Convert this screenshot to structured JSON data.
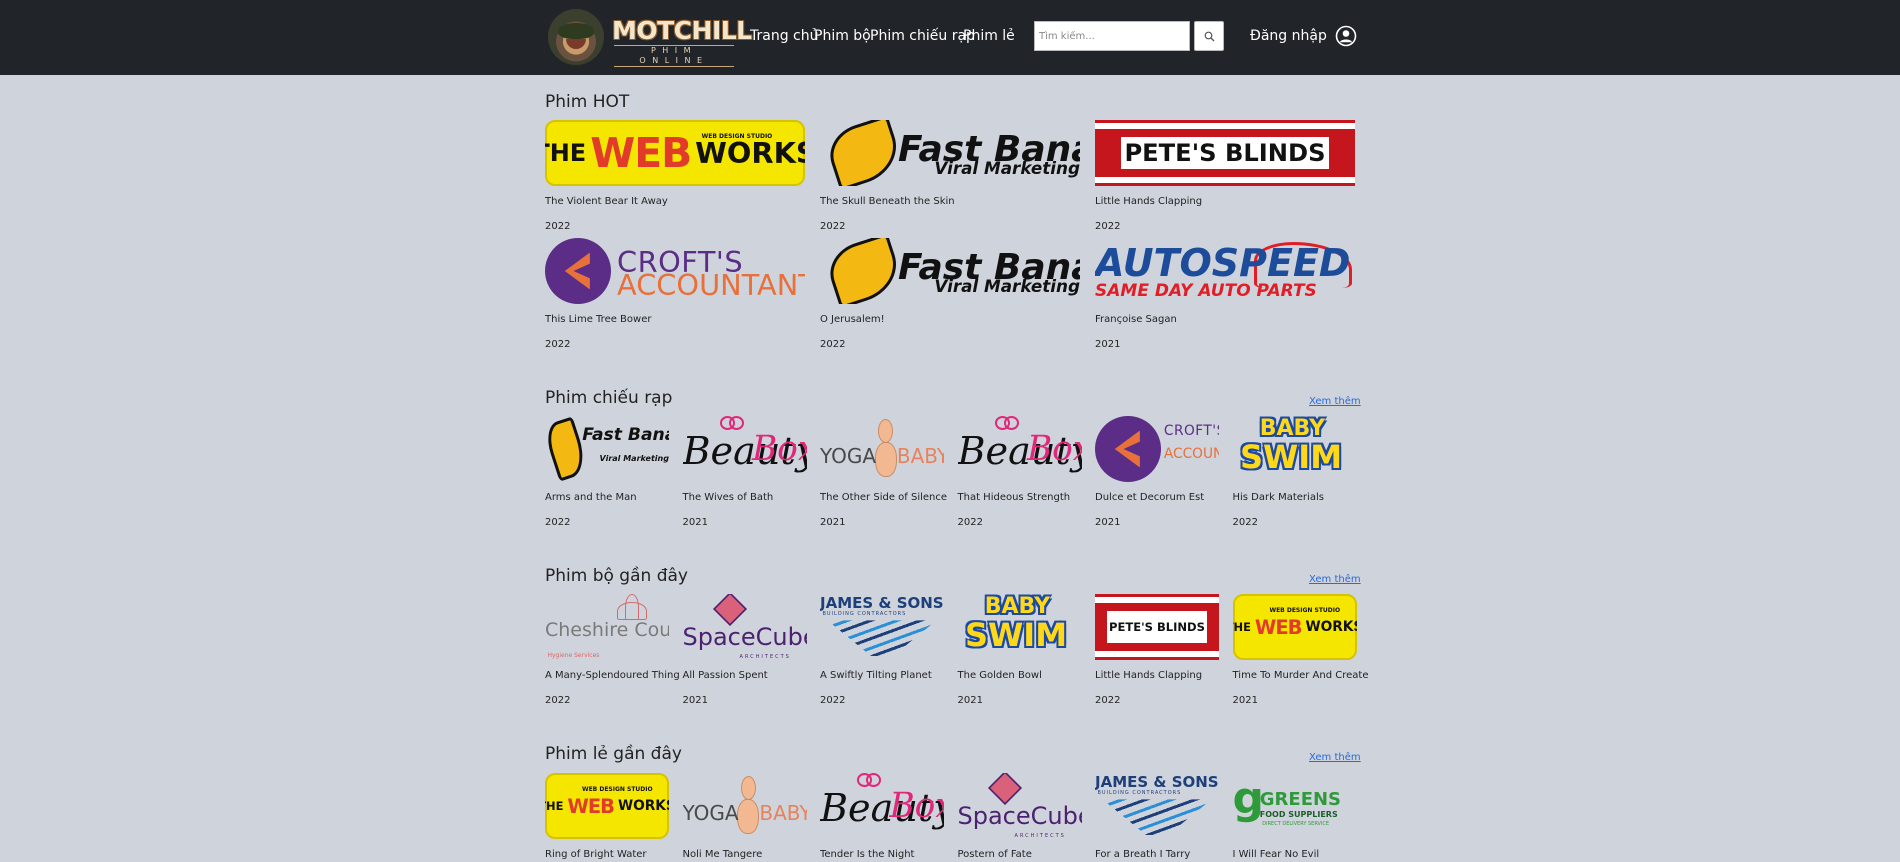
{
  "header": {
    "logo_main": "MOTCHILL",
    "logo_sub": "PHIM ONLINE",
    "nav": [
      "Trang chủ",
      "Phim bộ",
      "Phim chiếu rạp",
      "Phim lẻ"
    ],
    "search_placeholder": "Tìm kiếm...",
    "login": "Đăng nhập"
  },
  "sections": {
    "hot": {
      "title": "Phim HOT",
      "items": [
        {
          "title": "The Violent Bear It Away",
          "year": "2022",
          "logo": "THE WEB WORKS"
        },
        {
          "title": "The Skull Beneath the Skin",
          "year": "2022",
          "logo": "Fast Banana"
        },
        {
          "title": "Little Hands Clapping",
          "year": "2022",
          "logo": "PETE'S BLINDS"
        },
        {
          "title": "This Lime Tree Bower",
          "year": "2022",
          "logo": "CROFT'S ACCOUNTANTS"
        },
        {
          "title": "O Jerusalem!",
          "year": "2022",
          "logo": "Fast Banana"
        },
        {
          "title": "Françoise Sagan",
          "year": "2021",
          "logo": "AUTOSPEED"
        }
      ]
    },
    "theater": {
      "title": "Phim chiếu rạp",
      "more": "Xem thêm",
      "items": [
        {
          "title": "Arms and the Man",
          "year": "2022",
          "logo": "Fast Banana"
        },
        {
          "title": "The Wives of Bath",
          "year": "2021",
          "logo": "BeautyBox"
        },
        {
          "title": "The Other Side of Silence",
          "year": "2021",
          "logo": "YOGA BABY"
        },
        {
          "title": "That Hideous Strength",
          "year": "2022",
          "logo": "BeautyBox"
        },
        {
          "title": "Dulce et Decorum Est",
          "year": "2021",
          "logo": "CROFT'S ACCOUNTANTS"
        },
        {
          "title": "His Dark Materials",
          "year": "2022",
          "logo": "BABY SWIM"
        }
      ]
    },
    "series": {
      "title": "Phim bộ gần đây",
      "more": "Xem thêm",
      "items": [
        {
          "title": "A Many-Splendoured Thing",
          "year": "2022",
          "logo": "Cheshire County"
        },
        {
          "title": "All Passion Spent",
          "year": "2021",
          "logo": "SpaceCube"
        },
        {
          "title": "A Swiftly Tilting Planet",
          "year": "2022",
          "logo": "JAMES & SONS"
        },
        {
          "title": "The Golden Bowl",
          "year": "2021",
          "logo": "BABY SWIM"
        },
        {
          "title": "Little Hands Clapping",
          "year": "2022",
          "logo": "PETE'S BLINDS"
        },
        {
          "title": "Time To Murder And Create",
          "year": "2021",
          "logo": "THE WEB WORKS"
        }
      ]
    },
    "movies": {
      "title": "Phim lẻ gần đây",
      "more": "Xem thêm",
      "items": [
        {
          "title": "Ring of Bright Water",
          "logo": "THE WEB WORKS"
        },
        {
          "title": "Noli Me Tangere",
          "logo": "YOGA BABY"
        },
        {
          "title": "Tender Is the Night",
          "logo": "BeautyBox"
        },
        {
          "title": "Postern of Fate",
          "logo": "SpaceCube"
        },
        {
          "title": "For a Breath I Tarry",
          "logo": "JAMES & SONS"
        },
        {
          "title": "I Will Fear No Evil",
          "logo": "GREENS"
        }
      ]
    }
  },
  "logo_text": {
    "web": {
      "a": "THE",
      "b": "WEB",
      "c": "WORKS",
      "sub": "WEB DESIGN STUDIO"
    },
    "banana": {
      "a": "Fast Banana",
      "b": "Viral Marketing"
    },
    "pete": "PETE'S BLINDS",
    "croft": {
      "a": "CROFT'S",
      "b": "ACCOUNTANTS"
    },
    "auto": {
      "a": "AUTOSPEED",
      "b": "SAME DAY AUTO PARTS"
    },
    "beauty": {
      "a": "Beauty",
      "b": "Box"
    },
    "yoga": {
      "a": "YOGA",
      "b": "BABY"
    },
    "swim": {
      "a": "BABY",
      "b": "SWIM"
    },
    "cheshire": {
      "a": "Cheshire County",
      "b": "Hygiene Services"
    },
    "space": {
      "a": "SpaceCube",
      "b": "ARCHITECTS"
    },
    "james": {
      "a": "JAMES & SONS",
      "b": "BUILDING CONTRACTORS"
    },
    "greens": {
      "a": "GREENS",
      "b": "FOOD SUPPLIERS",
      "c": "DIRECT DELIVERY SERVICE",
      "g": "g"
    }
  },
  "colors": {
    "header_bg": "#212529",
    "page_bg": "#cfd4dc",
    "link": "#2a6bd6"
  }
}
